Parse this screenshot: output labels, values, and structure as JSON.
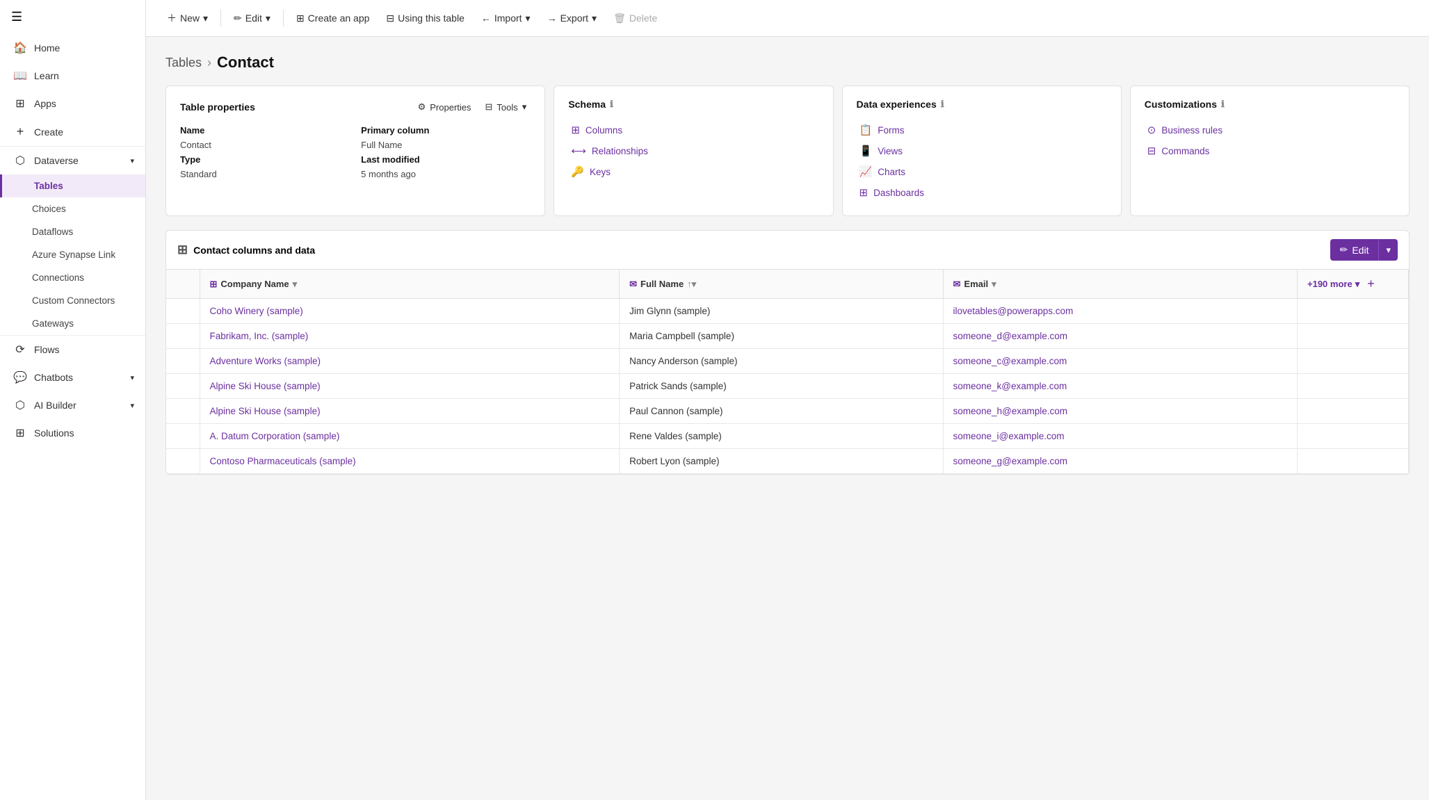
{
  "sidebar": {
    "hamburger": "☰",
    "items": [
      {
        "id": "home",
        "label": "Home",
        "icon": "🏠",
        "active": false
      },
      {
        "id": "learn",
        "label": "Learn",
        "icon": "📖",
        "active": false
      },
      {
        "id": "apps",
        "label": "Apps",
        "icon": "⊞",
        "active": false
      },
      {
        "id": "create",
        "label": "Create",
        "icon": "+",
        "active": false
      },
      {
        "id": "dataverse",
        "label": "Dataverse",
        "icon": "⬡",
        "active": false,
        "hasChevron": true,
        "expanded": true
      },
      {
        "id": "tables",
        "label": "Tables",
        "sub": true,
        "active": true
      },
      {
        "id": "choices",
        "label": "Choices",
        "sub": true,
        "active": false
      },
      {
        "id": "dataflows",
        "label": "Dataflows",
        "sub": true,
        "active": false
      },
      {
        "id": "azure-synapse-link",
        "label": "Azure Synapse Link",
        "sub": true,
        "active": false
      },
      {
        "id": "connections",
        "label": "Connections",
        "sub": true,
        "active": false
      },
      {
        "id": "custom-connectors",
        "label": "Custom Connectors",
        "sub": true,
        "active": false
      },
      {
        "id": "gateways",
        "label": "Gateways",
        "sub": true,
        "active": false
      },
      {
        "id": "flows",
        "label": "Flows",
        "icon": "⟳",
        "active": false
      },
      {
        "id": "chatbots",
        "label": "Chatbots",
        "icon": "💬",
        "active": false,
        "hasChevron": true
      },
      {
        "id": "ai-builder",
        "label": "AI Builder",
        "icon": "⬡",
        "active": false,
        "hasChevron": true
      },
      {
        "id": "solutions",
        "label": "Solutions",
        "icon": "⊞",
        "active": false
      }
    ]
  },
  "topbar": {
    "new_label": "New",
    "edit_label": "Edit",
    "create_app_label": "Create an app",
    "using_table_label": "Using this table",
    "import_label": "Import",
    "export_label": "Export",
    "delete_label": "Delete"
  },
  "breadcrumb": {
    "tables": "Tables",
    "separator": "›",
    "contact": "Contact"
  },
  "table_properties_card": {
    "title": "Table properties",
    "properties_btn": "Properties",
    "tools_btn": "Tools",
    "name_label": "Name",
    "name_value": "Contact",
    "primary_column_label": "Primary column",
    "primary_column_value": "Full Name",
    "type_label": "Type",
    "type_value": "Standard",
    "last_modified_label": "Last modified",
    "last_modified_value": "5 months ago"
  },
  "schema_card": {
    "title": "Schema",
    "info_icon": "ℹ",
    "columns": "Columns",
    "relationships": "Relationships",
    "keys": "Keys"
  },
  "data_experiences_card": {
    "title": "Data experiences",
    "info_icon": "ℹ",
    "forms": "Forms",
    "views": "Views",
    "charts": "Charts",
    "dashboards": "Dashboards"
  },
  "customizations_card": {
    "title": "Customizations",
    "info_icon": "ℹ",
    "business_rules": "Business rules",
    "commands": "Commands"
  },
  "data_section": {
    "title": "Contact columns and data",
    "edit_label": "Edit",
    "more_cols": "+190 more"
  },
  "table_columns": [
    {
      "id": "company-name",
      "label": "Company Name",
      "icon": "⊞",
      "sort": "▾"
    },
    {
      "id": "full-name",
      "label": "Full Name",
      "icon": "✉",
      "sort": "↑▾"
    },
    {
      "id": "email",
      "label": "Email",
      "icon": "✉",
      "sort": "▾"
    }
  ],
  "table_rows": [
    {
      "company": "Coho Winery (sample)",
      "full_name": "Jim Glynn (sample)",
      "email": "ilovetables@powerapps.com"
    },
    {
      "company": "Fabrikam, Inc. (sample)",
      "full_name": "Maria Campbell (sample)",
      "email": "someone_d@example.com"
    },
    {
      "company": "Adventure Works (sample)",
      "full_name": "Nancy Anderson (sample)",
      "email": "someone_c@example.com"
    },
    {
      "company": "Alpine Ski House (sample)",
      "full_name": "Patrick Sands (sample)",
      "email": "someone_k@example.com"
    },
    {
      "company": "Alpine Ski House (sample)",
      "full_name": "Paul Cannon (sample)",
      "email": "someone_h@example.com"
    },
    {
      "company": "A. Datum Corporation (sample)",
      "full_name": "Rene Valdes (sample)",
      "email": "someone_i@example.com"
    },
    {
      "company": "Contoso Pharmaceuticals (sample)",
      "full_name": "Robert Lyon (sample)",
      "email": "someone_g@example.com"
    }
  ]
}
